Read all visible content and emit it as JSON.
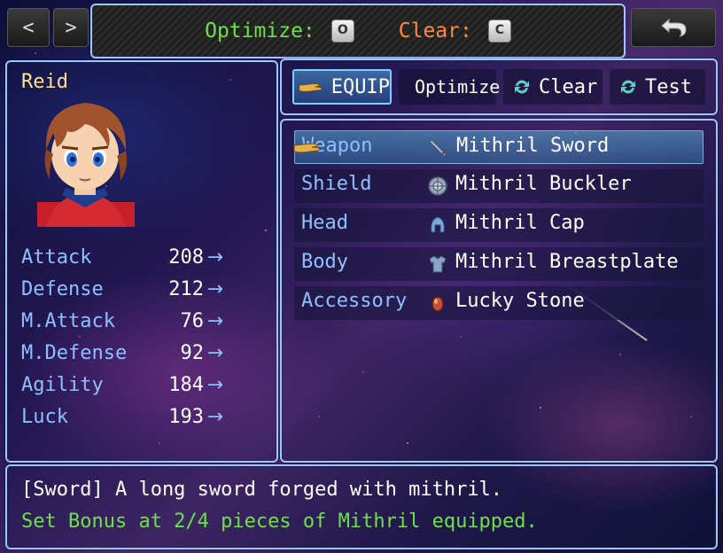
{
  "top": {
    "back_label": "<",
    "forward_label": ">",
    "optimize_label": "Optimize:",
    "optimize_key": "O",
    "clear_label": "Clear:",
    "clear_key": "C",
    "optimize_color": "#6ee04a",
    "clear_color": "#ff8a3c"
  },
  "actor": {
    "name": "Reid",
    "stats": [
      {
        "label": "Attack",
        "value": "208",
        "arrow": "→"
      },
      {
        "label": "Defense",
        "value": "212",
        "arrow": "→"
      },
      {
        "label": "M.Attack",
        "value": "76",
        "arrow": "→"
      },
      {
        "label": "M.Defense",
        "value": "92",
        "arrow": "→"
      },
      {
        "label": "Agility",
        "value": "184",
        "arrow": "→"
      },
      {
        "label": "Luck",
        "value": "193",
        "arrow": "→"
      }
    ]
  },
  "commands": [
    {
      "label": "EQUIP",
      "icon": "hand-pointer-icon",
      "selected": true
    },
    {
      "label": "Optimize",
      "icon": "double-chevron-up-icon",
      "selected": false
    },
    {
      "label": "Clear",
      "icon": "refresh-icon",
      "selected": false
    },
    {
      "label": "Test",
      "icon": "refresh-icon",
      "selected": false
    }
  ],
  "slots": [
    {
      "slot": "Weapon",
      "item": "Mithril Sword",
      "icon": "sword-icon",
      "selected": true
    },
    {
      "slot": "Shield",
      "item": "Mithril Buckler",
      "icon": "shield-icon",
      "selected": false
    },
    {
      "slot": "Head",
      "item": "Mithril Cap",
      "icon": "helmet-icon",
      "selected": false
    },
    {
      "slot": "Body",
      "item": "Mithril Breastplate",
      "icon": "armor-icon",
      "selected": false
    },
    {
      "slot": "Accessory",
      "item": "Lucky Stone",
      "icon": "stone-icon",
      "selected": false
    }
  ],
  "help": {
    "line1": "[Sword] A long sword forged with mithril.",
    "line2": "Set Bonus at 2/4 pieces of Mithril equipped."
  },
  "colors": {
    "window_border": "#9ec6ff",
    "system_text": "#8ec0ff",
    "actor_name": "#ffe08a",
    "set_bonus": "#6ee04a"
  }
}
